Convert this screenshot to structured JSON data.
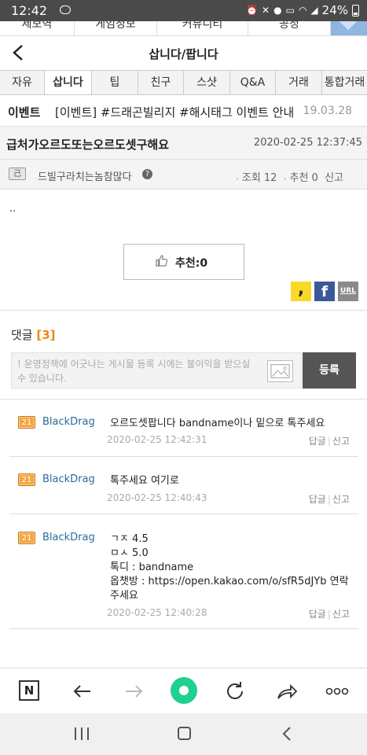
{
  "status": {
    "time": "12:42",
    "talk": "TALK",
    "battery": "24%"
  },
  "topmenu": [
    "제보역",
    "게임정보",
    "커뮤니티",
    "공정"
  ],
  "header": {
    "title": "삽니다/팝니다"
  },
  "tabs": [
    {
      "label": "자유",
      "active": false
    },
    {
      "label": "삽니다",
      "active": true
    },
    {
      "label": "팁",
      "active": false
    },
    {
      "label": "친구",
      "active": false
    },
    {
      "label": "스샷",
      "active": false
    },
    {
      "label": "Q&A",
      "active": false
    },
    {
      "label": "거래",
      "active": false
    },
    {
      "label": "통합거래",
      "active": false
    }
  ],
  "notice": {
    "label": "이벤트",
    "text": "[이벤트] #드래곤빌리지 #해시태그 이벤트 안내",
    "date": "19.03.28"
  },
  "post": {
    "title": "급처가오르도또는오르도셋구해요",
    "date": "2020-02-25 12:37:45",
    "author": "드빌구라치는놈참많다",
    "author_level": "己",
    "help": "?",
    "views": "조회 12",
    "recommends": "추천 0",
    "report": "신고",
    "body": "..",
    "recommend_button": "추천:0"
  },
  "share": {
    "kakaostory": ",",
    "facebook": "f",
    "url": "URL"
  },
  "comments_section": {
    "title": "댓글",
    "count": "[3]",
    "placeholder": "! 운영정책에 어긋나는 게시물 등록 시에는 불이익을 받으실 수 있습니다.",
    "submit": "등록"
  },
  "comments": [
    {
      "level": "21",
      "author": "BlackDrag",
      "lines": [
        "오르도셋팝니다 bandname이나 밑으로 톡주세요"
      ],
      "date": "2020-02-25 12:42:31",
      "reply": "답글",
      "report": "신고"
    },
    {
      "level": "21",
      "author": "BlackDrag",
      "lines": [
        "톡주세요 여기로"
      ],
      "date": "2020-02-25 12:40:43",
      "reply": "답글",
      "report": "신고"
    },
    {
      "level": "21",
      "author": "BlackDrag",
      "lines": [
        "ㄱㅈ 4.5",
        "ㅁㅅ 5.0",
        "톡디 : bandname",
        "옵챗방 : https://open.kakao.com/o/sfR5dJYb 연락",
        "주세요"
      ],
      "date": "2020-02-25 12:40:28",
      "reply": "답글",
      "report": "신고"
    }
  ],
  "browser": {
    "n_label": "N"
  }
}
